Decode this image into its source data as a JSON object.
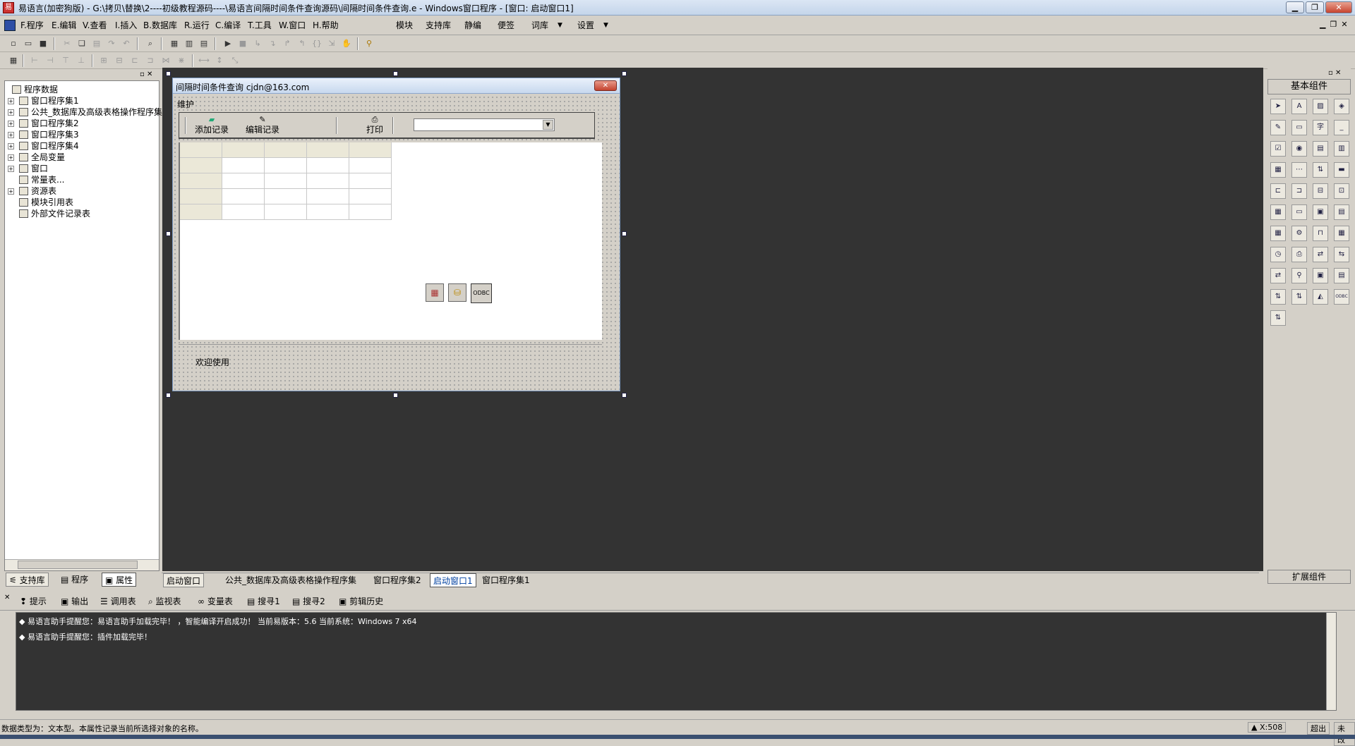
{
  "title": "易语言(加密狗版) - G:\\拷贝\\替换\\2----初级教程源码----\\易语言间隔时间条件查询源码\\间隔时间条件查询.e - Windows窗口程序 - [窗口: 启动窗口1]",
  "menu": [
    "F.程序",
    "E.编辑",
    "V.查看",
    "I.插入",
    "B.数据库",
    "R.运行",
    "C.编译",
    "T.工具",
    "W.窗口",
    "H.帮助"
  ],
  "menu2": [
    "模块",
    "支持库",
    "静编",
    "便签",
    "词库",
    "设置"
  ],
  "tree": [
    {
      "label": "程序数据",
      "plus": false,
      "indent": 0
    },
    {
      "label": "窗口程序集1",
      "plus": true,
      "indent": 1
    },
    {
      "label": "公共_数据库及高级表格操作程序集",
      "plus": true,
      "indent": 1
    },
    {
      "label": "窗口程序集2",
      "plus": true,
      "indent": 1
    },
    {
      "label": "窗口程序集3",
      "plus": true,
      "indent": 1
    },
    {
      "label": "窗口程序集4",
      "plus": true,
      "indent": 1
    },
    {
      "label": "全局变量",
      "plus": true,
      "indent": 1
    },
    {
      "label": "窗口",
      "plus": true,
      "indent": 1
    },
    {
      "label": "常量表...",
      "plus": false,
      "indent": 1
    },
    {
      "label": "资源表",
      "plus": true,
      "indent": 1
    },
    {
      "label": "模块引用表",
      "plus": false,
      "indent": 1
    },
    {
      "label": "外部文件记录表",
      "plus": false,
      "indent": 1
    }
  ],
  "left_tabs": [
    "支持库",
    "程序",
    "属性"
  ],
  "form": {
    "title": "间隔时间条件查询    cjdn@163.com",
    "menu": "维护",
    "btn_add": "添加记录",
    "btn_edit": "编辑记录",
    "btn_print": "打印",
    "status": "欢迎使用"
  },
  "bottom_tabs": [
    "启动窗口",
    "公共_数据库及高级表格操作程序集",
    "窗口程序集2",
    "启动窗口1",
    "窗口程序集1"
  ],
  "output_tabs": [
    "提示",
    "输出",
    "调用表",
    "监视表",
    "变量表",
    "搜寻1",
    "搜寻2",
    "剪辑历史"
  ],
  "output_lines": [
    "易语言助手提醒您：易语言助手加载完毕！ ，智能编译开启成功！ 当前易版本：5.6  当前系统：Windows 7 x64",
    "易语言助手提醒您：插件加载完毕！"
  ],
  "right_panel": {
    "header": "基本组件",
    "footer": "扩展组件"
  },
  "statusbar": {
    "text": "数据类型为：文本型。本属性记录当前所选择对象的名称。",
    "coord": "X:508",
    "overflow": "超出",
    "mode": "未改"
  }
}
